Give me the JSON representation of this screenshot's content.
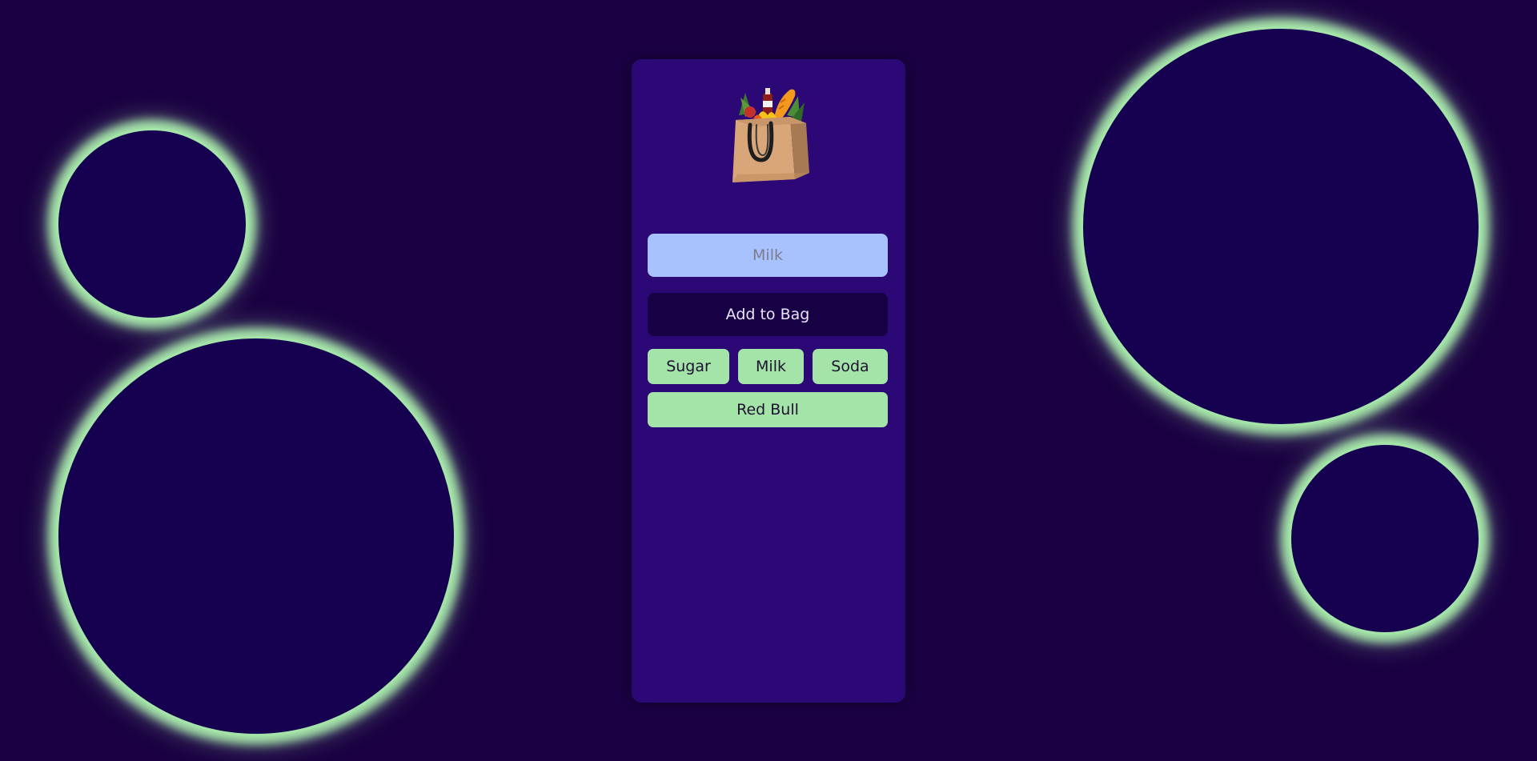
{
  "app": {
    "logo_icon": "grocery-bag-icon"
  },
  "input": {
    "placeholder": "Milk",
    "value": ""
  },
  "add_button": {
    "label": "Add to Bag"
  },
  "suggestions": [
    {
      "label": "Sugar"
    },
    {
      "label": "Milk"
    },
    {
      "label": "Soda"
    },
    {
      "label": "Red Bull"
    }
  ],
  "colors": {
    "background": "#1a0042",
    "panel": "#2c0876",
    "bubble_fill": "#160050",
    "bubble_glow": "#a5e4a9",
    "input_bg": "#a8c2ff",
    "button_bg": "#170044",
    "chip_bg": "#a5e4a9"
  }
}
